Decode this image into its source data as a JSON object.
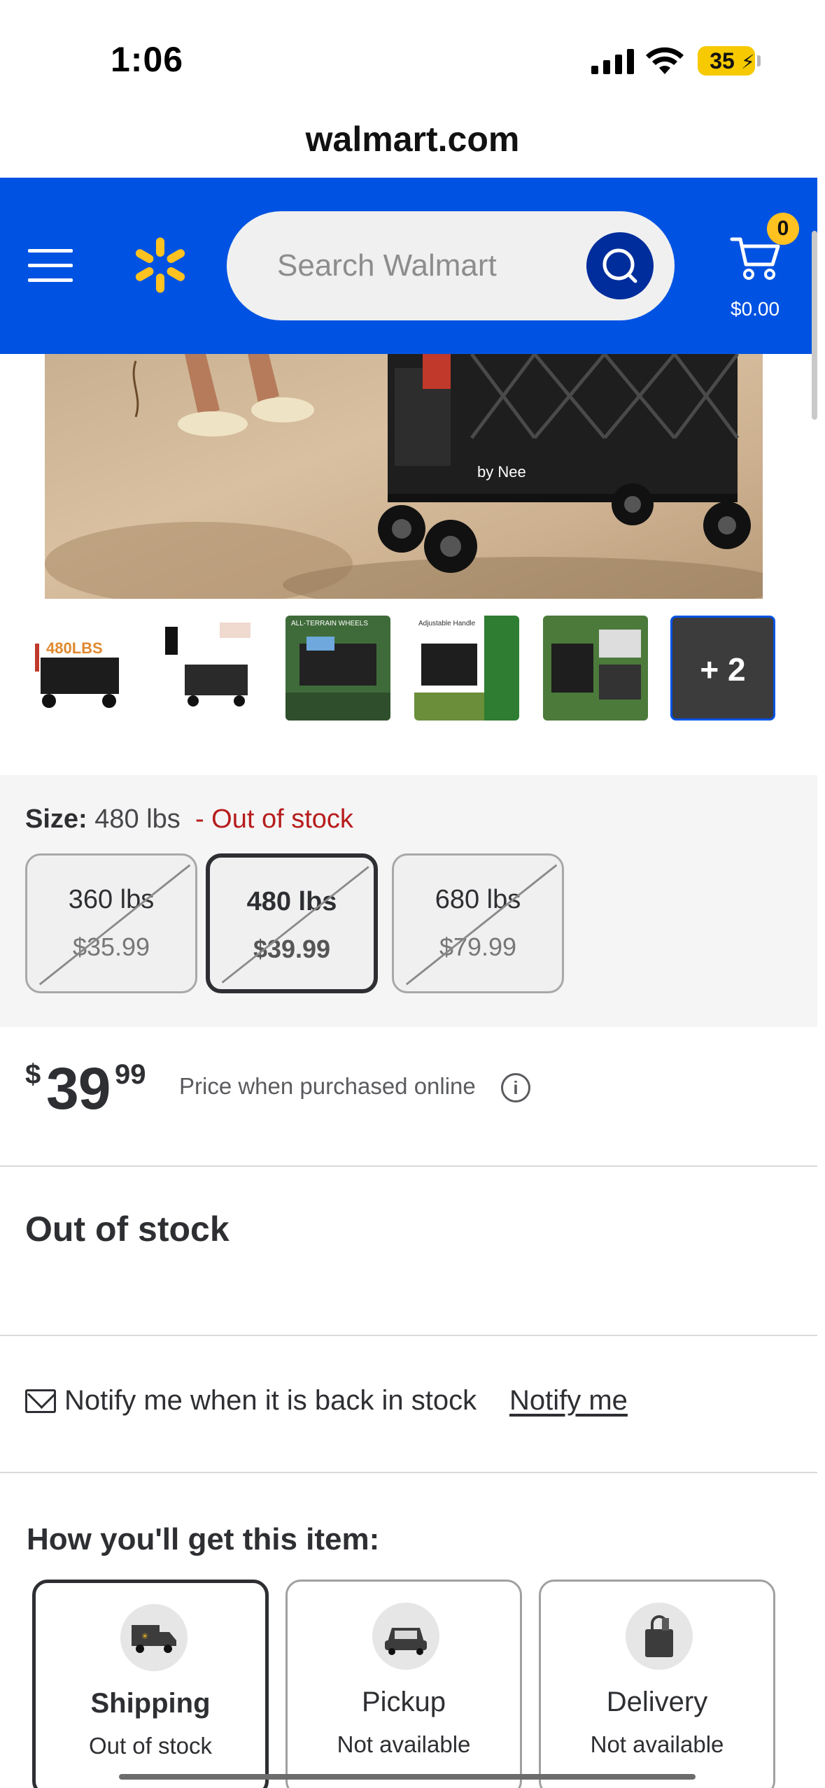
{
  "status_bar": {
    "time": "1:06",
    "battery": "35"
  },
  "browser": {
    "url": "walmart.com"
  },
  "header": {
    "search_placeholder": "Search Walmart",
    "cart_count": "0",
    "cart_total": "$0.00",
    "brand_color": "#0053e2",
    "spark_color": "#ffc220"
  },
  "hero": {
    "watermark": "by Nee"
  },
  "thumbnails": {
    "labels": [
      "480LBS",
      "ALL-TERRAIN WHEELS",
      "Adjustable Handle"
    ],
    "more_label": "+ 2"
  },
  "size": {
    "label": "Size:",
    "value": "480 lbs",
    "status": "- Out of stock",
    "options": [
      {
        "label": "360 lbs",
        "price": "$35.99"
      },
      {
        "label": "480 lbs",
        "price": "$39.99"
      },
      {
        "label": "680 lbs",
        "price": "$79.99"
      }
    ]
  },
  "price": {
    "dollar_sign": "$",
    "whole": "39",
    "cents": "99",
    "note": "Price when purchased online"
  },
  "availability": {
    "heading": "Out of stock"
  },
  "notify": {
    "text": "Notify me when it is back in stock",
    "link": "Notify me"
  },
  "fulfillment": {
    "heading": "How you'll get this item:",
    "options": [
      {
        "title": "Shipping",
        "status": "Out of stock",
        "icon": "truck-icon"
      },
      {
        "title": "Pickup",
        "status": "Not available",
        "icon": "car-icon"
      },
      {
        "title": "Delivery",
        "status": "Not available",
        "icon": "bag-icon"
      }
    ]
  }
}
